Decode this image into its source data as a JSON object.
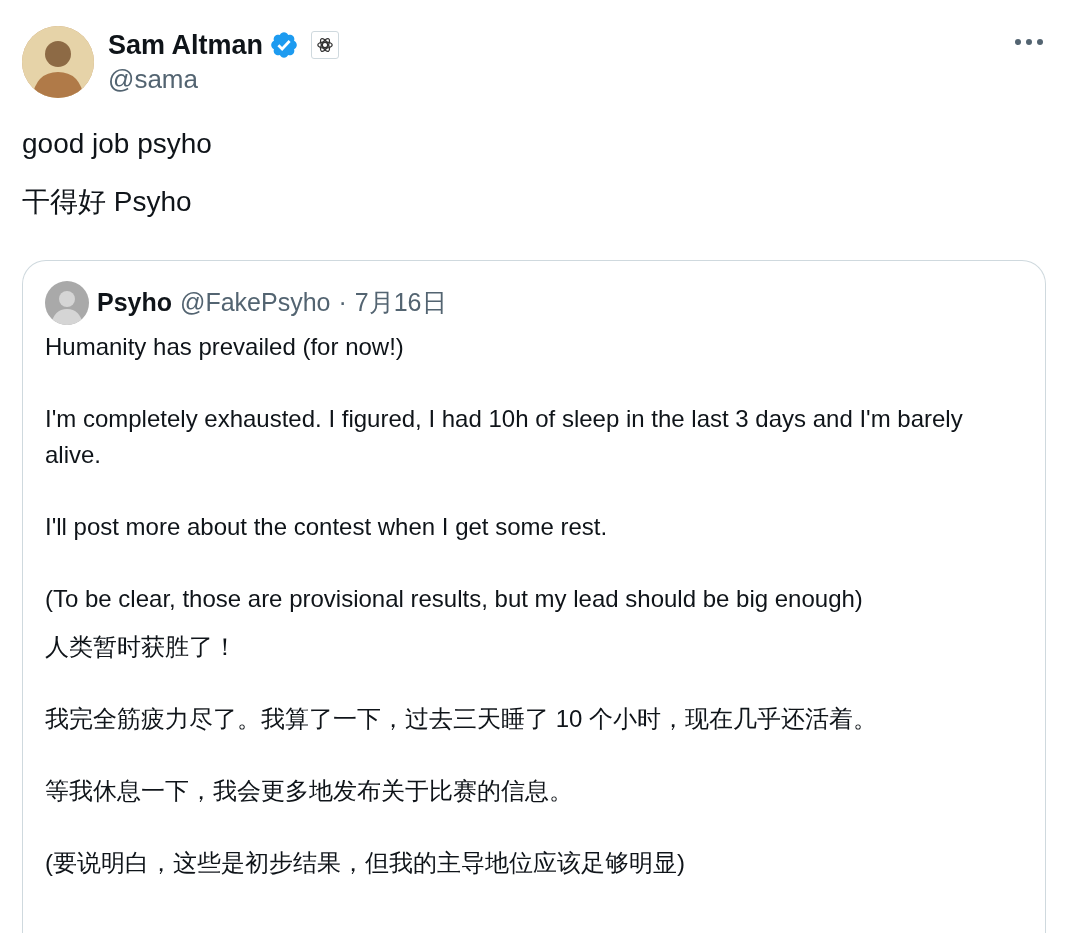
{
  "tweet": {
    "author": {
      "name": "Sam Altman",
      "handle": "@sama",
      "verified": true,
      "affiliate_badge": true
    },
    "lines": [
      "good job psyho",
      "干得好 Psyho"
    ],
    "quoted": {
      "name": "Psyho",
      "handle": "@FakePsyho",
      "separator": "·",
      "date": "7月16日",
      "paragraphs": [
        "Humanity has prevailed (for now!)",
        "I'm completely exhausted. I figured, I had 10h of sleep in the last 3 days and I'm barely alive.",
        "I'll post more about the contest when I get some rest.",
        "(To be clear, those are provisional results, but my lead should be big enough)"
      ],
      "translation": [
        "人类暂时获胜了！",
        "我完全筋疲力尽了。我算了一下，过去三天睡了 10 个小时，现在几乎还活着。",
        "等我休息一下，我会更多地发布关于比赛的信息。",
        "(要说明白，这些是初步结果，但我的主导地位应该足够明显)"
      ]
    }
  }
}
